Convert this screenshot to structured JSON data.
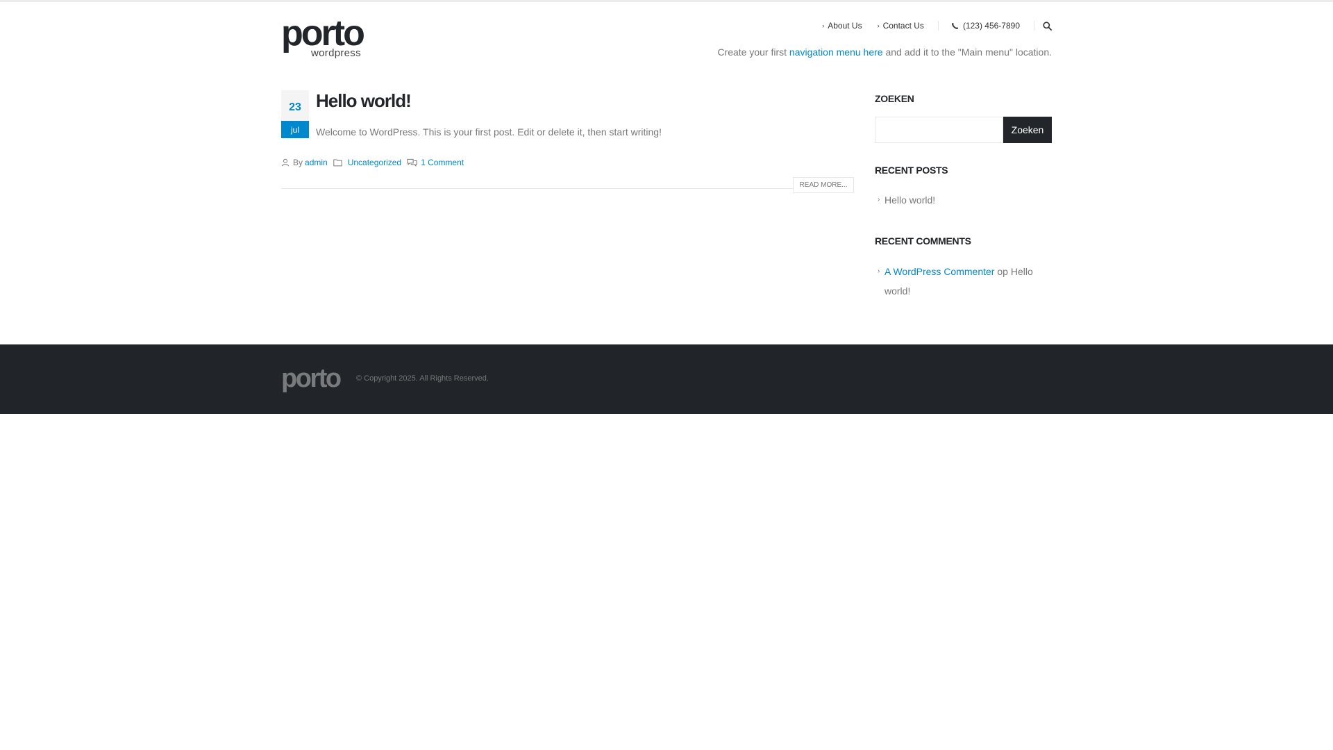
{
  "header": {
    "logo_main": "porto",
    "logo_sub": "wordpress",
    "nav": [
      {
        "label": "About Us"
      },
      {
        "label": "Contact Us"
      }
    ],
    "phone": "(123) 456-7890",
    "menu_note": {
      "prefix": "Create your first",
      "link": "navigation menu here",
      "suffix": "and add it to the \"Main menu\" location."
    }
  },
  "post": {
    "day": "23",
    "month": "jul",
    "title": "Hello world!",
    "excerpt": "Welcome to WordPress. This is your first post. Edit or delete it, then start writing!",
    "by_label": "By",
    "author": "admin",
    "category": "Uncategorized",
    "comments": "1 Comment",
    "read_more": "READ MORE..."
  },
  "sidebar": {
    "search_title": "ZOEKEN",
    "search_button": "Zoeken",
    "recent_posts_title": "RECENT POSTS",
    "recent_posts": [
      {
        "label": "Hello world!"
      }
    ],
    "recent_comments_title": "RECENT COMMENTS",
    "recent_comments": [
      {
        "author": "A WordPress Commenter",
        "connector": "op",
        "post": "Hello world!"
      }
    ]
  },
  "footer": {
    "logo": "porto",
    "copyright": "© Copyright 2025. All Rights Reserved."
  },
  "colors": {
    "accent": "#0088cc",
    "dark": "#222529",
    "footer_bg": "#212529"
  }
}
